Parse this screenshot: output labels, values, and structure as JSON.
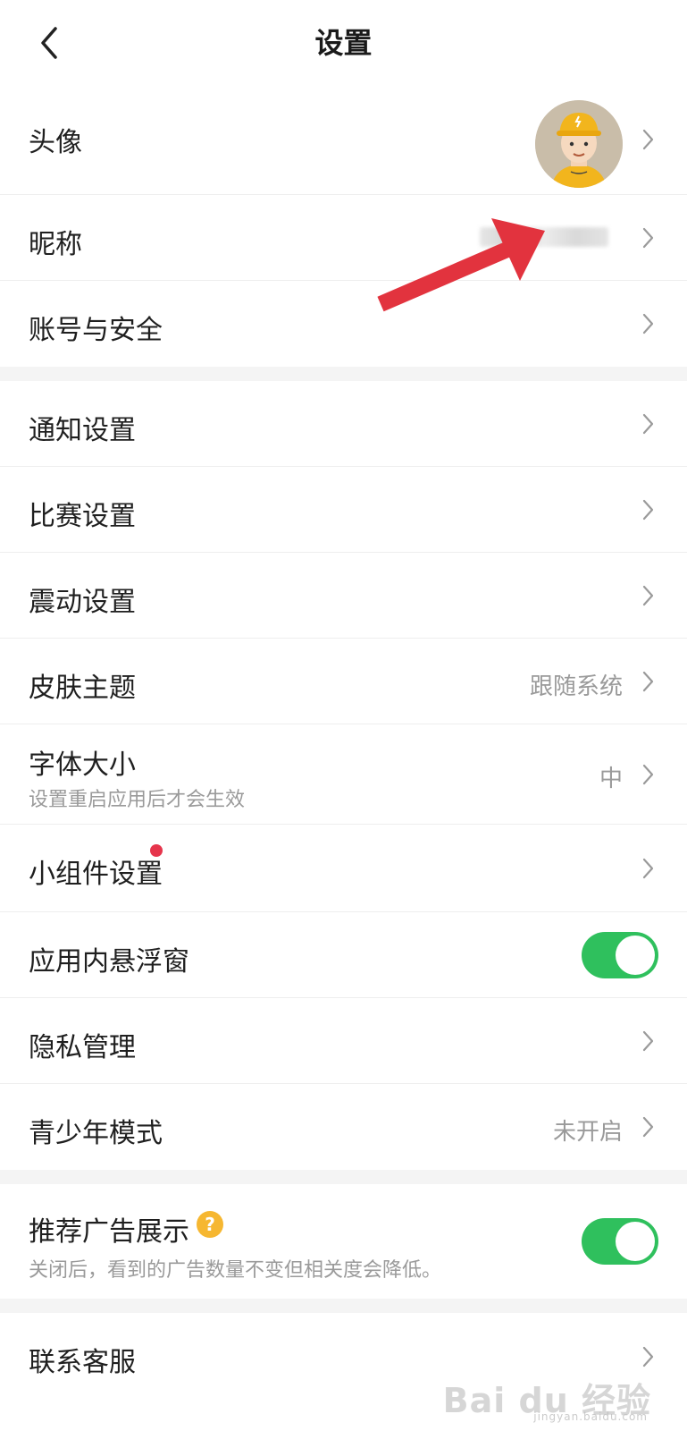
{
  "header": {
    "title": "设置"
  },
  "group1": {
    "avatar": {
      "label": "头像"
    },
    "nickname": {
      "label": "昵称"
    },
    "account": {
      "label": "账号与安全"
    }
  },
  "group2": {
    "notification": {
      "label": "通知设置"
    },
    "match": {
      "label": "比赛设置"
    },
    "vibration": {
      "label": "震动设置"
    },
    "skin": {
      "label": "皮肤主题",
      "value": "跟随系统"
    },
    "font": {
      "label": "字体大小",
      "sub": "设置重启应用后才会生效",
      "value": "中"
    },
    "widget": {
      "label": "小组件设置"
    },
    "floating": {
      "label": "应用内悬浮窗",
      "on": true
    },
    "privacy": {
      "label": "隐私管理"
    },
    "teen": {
      "label": "青少年模式",
      "value": "未开启"
    }
  },
  "group3": {
    "ads": {
      "label": "推荐广告展示",
      "help_icon": "?",
      "sub": "关闭后，看到的广告数量不变但相关度会降低。",
      "on": true
    }
  },
  "group4": {
    "service": {
      "label": "联系客服"
    }
  },
  "watermark": {
    "main": "Bai du 经验",
    "sub": "jingyan.baidu.com"
  },
  "colors": {
    "toggle_on": "#2fc05d",
    "badge_dot": "#e6354c",
    "help": "#f6b731",
    "arrow": "#e2333e"
  }
}
